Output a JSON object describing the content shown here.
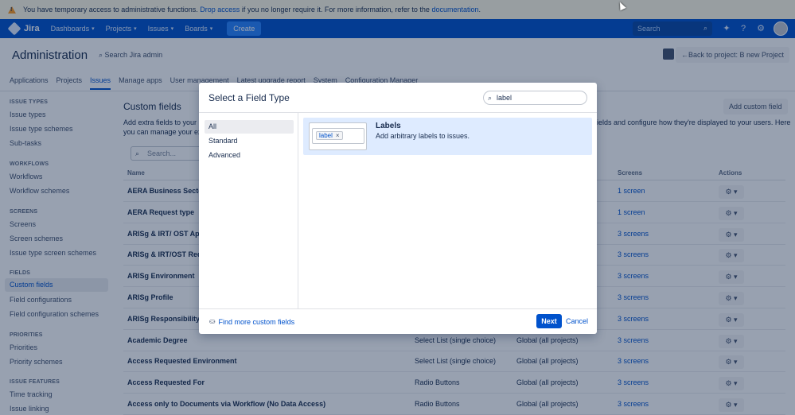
{
  "banner": {
    "text_before": "You have temporary access to administrative functions. ",
    "drop_link": "Drop access",
    "text_middle": " if you no longer require it. For more information, refer to the ",
    "doc_link": "documentation",
    "text_after": "."
  },
  "topnav": {
    "logo": "Jira",
    "items": [
      "Dashboards",
      "Projects",
      "Issues",
      "Boards"
    ],
    "create": "Create",
    "search_placeholder": "Search"
  },
  "admin": {
    "title": "Administration",
    "search": "Search Jira admin",
    "back": "Back to project: B new Project",
    "tabs": [
      "Applications",
      "Projects",
      "Issues",
      "Manage apps",
      "User management",
      "Latest upgrade report",
      "System",
      "Configuration Manager"
    ]
  },
  "sidebar": {
    "sections": [
      {
        "heading": "ISSUE TYPES",
        "items": [
          "Issue types",
          "Issue type schemes",
          "Sub-tasks"
        ]
      },
      {
        "heading": "WORKFLOWS",
        "items": [
          "Workflows",
          "Workflow schemes"
        ]
      },
      {
        "heading": "SCREENS",
        "items": [
          "Screens",
          "Screen schemes",
          "Issue type screen schemes"
        ]
      },
      {
        "heading": "FIELDS",
        "items": [
          "Custom fields",
          "Field configurations",
          "Field configuration schemes"
        ]
      },
      {
        "heading": "PRIORITIES",
        "items": [
          "Priorities",
          "Priority schemes"
        ]
      },
      {
        "heading": "ISSUE FEATURES",
        "items": [
          "Time tracking",
          "Issue linking"
        ]
      }
    ]
  },
  "main": {
    "title": "Custom fields",
    "add_button": "Add custom field",
    "desc_line1": "Add extra fields to your is",
    "desc_line2": "you can manage your exi",
    "desc_right1": "ields and configure how they're displayed to your users. Here",
    "desc_right2": "",
    "filter_placeholder": "Search...",
    "columns": {
      "name": "Name",
      "screens": "Screens",
      "actions": "Actions"
    },
    "rows": [
      {
        "name": "AERA Business Sector",
        "type": "",
        "context": "",
        "screens": "1 screen"
      },
      {
        "name": "AERA Request type",
        "type": "",
        "context": "",
        "screens": "1 screen"
      },
      {
        "name": "ARISg & IRT/ OST App",
        "type": "",
        "context": "",
        "screens": "3 screens"
      },
      {
        "name": "ARISg & IRT/OST Requ",
        "type": "",
        "context": "",
        "screens": "3 screens"
      },
      {
        "name": "ARISg Environment",
        "type": "",
        "context": "",
        "screens": "3 screens"
      },
      {
        "name": "ARISg Profile",
        "type": "",
        "context": "",
        "screens": "3 screens"
      },
      {
        "name": "ARISg Responsibility",
        "type": "",
        "context": "",
        "screens": "3 screens"
      },
      {
        "name": "Academic Degree",
        "type": "Select List (single choice)",
        "context": "Global (all projects)",
        "screens": "3 screens"
      },
      {
        "name": "Access Requested Environment",
        "type": "Select List (single choice)",
        "context": "Global (all projects)",
        "screens": "3 screens"
      },
      {
        "name": "Access Requested For",
        "type": "Radio Buttons",
        "context": "Global (all projects)",
        "screens": "3 screens"
      },
      {
        "name": "Access only to Documents via Workflow (No Data Access)",
        "type": "Radio Buttons",
        "context": "Global (all projects)",
        "screens": "3 screens"
      }
    ]
  },
  "dialog": {
    "title": "Select a Field Type",
    "search_value": "label",
    "categories": [
      "All",
      "Standard",
      "Advanced"
    ],
    "option": {
      "name": "Labels",
      "description": "Add arbitrary labels to issues.",
      "preview_tag": "label"
    },
    "find_more": "Find more custom fields",
    "next": "Next",
    "cancel": "Cancel"
  }
}
